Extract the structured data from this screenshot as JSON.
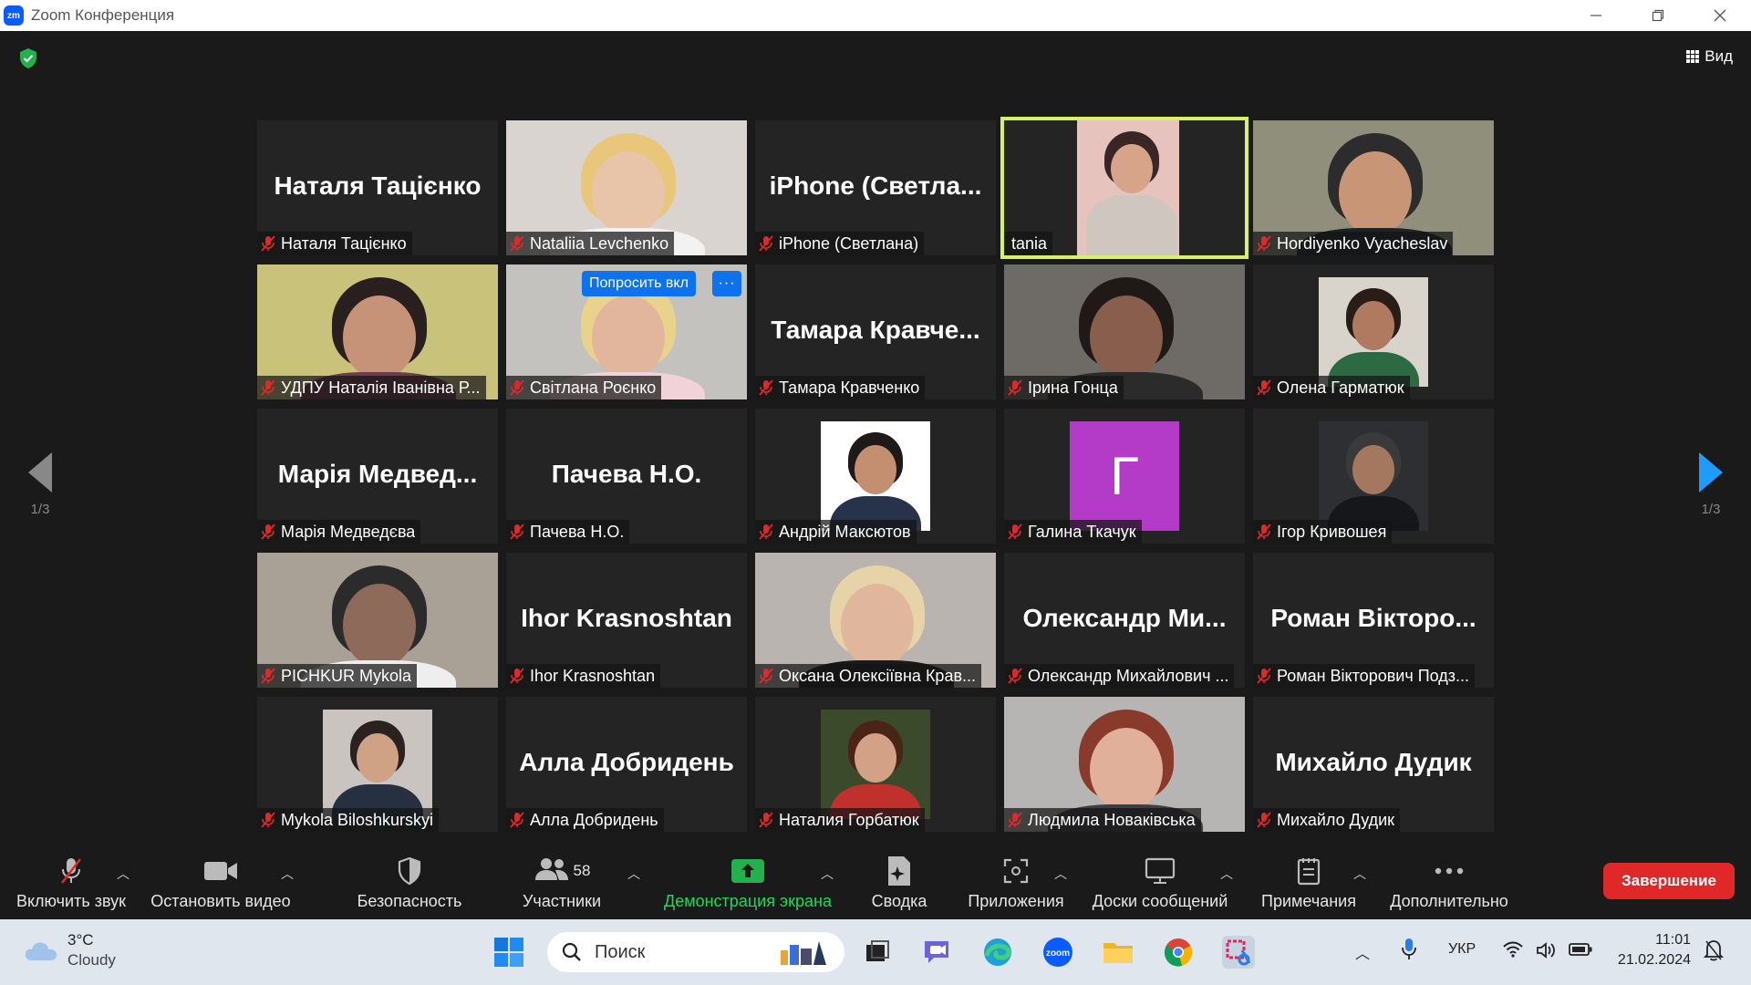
{
  "window": {
    "title": "Zoom Конференция",
    "logo_text": "zm"
  },
  "header": {
    "view_label": "Вид"
  },
  "pagination": {
    "left_page": "1/3",
    "right_page": "1/3"
  },
  "participants": [
    {
      "label": "Наталя Тацієнко",
      "big_name": "Наталя Тацієнко",
      "video": false
    },
    {
      "label": "Nataliia Levchenko",
      "video": true
    },
    {
      "label": "iPhone (Светлана)",
      "big_name": "iPhone (Светла...",
      "video": false
    },
    {
      "label": "tania",
      "video": true,
      "active": true,
      "muted": false
    },
    {
      "label": "Hordiyenko Vyacheslav",
      "video": true
    },
    {
      "label": "УДПУ Наталія Іванівна Р...",
      "video": true
    },
    {
      "label": "Світлана Роєнко",
      "video": true,
      "ask_button": "Попросить вкл",
      "more_button": "···"
    },
    {
      "label": "Тамара Кравченко",
      "big_name": "Тамара Кравче...",
      "video": false
    },
    {
      "label": "Ірина Гонца",
      "video": true
    },
    {
      "label": "Олена Гарматюк",
      "video": true
    },
    {
      "label": "Марія Медведєва",
      "big_name": "Марія Медвед...",
      "video": false
    },
    {
      "label": "Пачева Н.О.",
      "big_name": "Пачева Н.О.",
      "video": false
    },
    {
      "label": "Андрій Максютов",
      "video": true
    },
    {
      "label": "Галина Ткачук",
      "video": true,
      "avatar_letter": "Г"
    },
    {
      "label": "Ігор Кривошея",
      "video": true
    },
    {
      "label": "PICHKUR Mykola",
      "video": true
    },
    {
      "label": "Ihor Krasnoshtan",
      "big_name": "Ihor Krasnoshtan",
      "video": false
    },
    {
      "label": "Оксана Олексіївна Крав...",
      "video": true
    },
    {
      "label": "Олександр Михайлович ...",
      "big_name": "Олександр Ми...",
      "video": false
    },
    {
      "label": "Роман Вікторович Подз...",
      "big_name": "Роман Вікторо...",
      "video": false
    },
    {
      "label": "Mykola Biloshkurskyi",
      "video": true
    },
    {
      "label": "Алла Добридень",
      "big_name": "Алла Добридень",
      "video": false
    },
    {
      "label": "Наталия Горбатюк",
      "video": true
    },
    {
      "label": "Людмила Новаківська",
      "video": true
    },
    {
      "label": "Михайло Дудик",
      "big_name": "Михайло Дудик",
      "video": false
    }
  ],
  "toolbar": {
    "unmute": "Включить звук",
    "stop_video": "Остановить видео",
    "security": "Безопасность",
    "participants": "Участники",
    "participants_count": "58",
    "share": "Демонстрация экрана",
    "summary": "Сводка",
    "apps": "Приложения",
    "whiteboards": "Доски сообщений",
    "notes": "Примечания",
    "more": "Дополнительно",
    "end": "Завершение"
  },
  "taskbar": {
    "temperature": "3°C",
    "weather": "Cloudy",
    "search_placeholder": "Поиск",
    "language": "УКР",
    "time": "11:01",
    "date": "21.02.2024"
  },
  "colors": {
    "end_button": "#e02828",
    "share_label": "#1ed760",
    "active_speaker": "#d8ef6c",
    "ask_button": "#0e72ed",
    "mic_off": "#e02828"
  }
}
